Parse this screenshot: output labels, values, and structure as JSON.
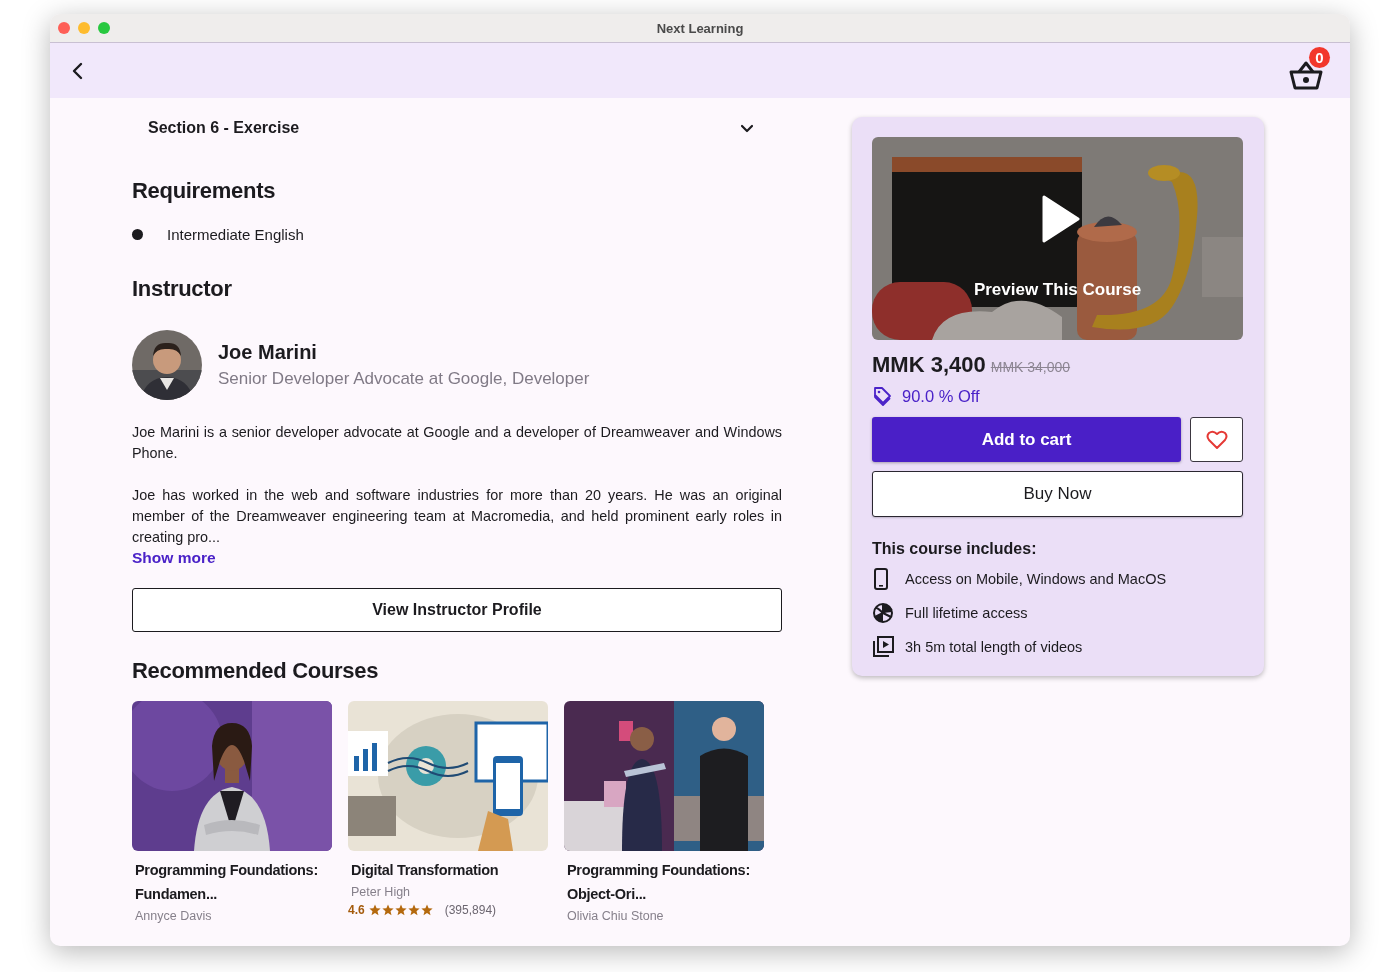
{
  "window": {
    "title": "Next Learning"
  },
  "cart": {
    "count": "0"
  },
  "section": {
    "title": "Section 6 - Exercise",
    "expanded": false
  },
  "requirements": {
    "heading": "Requirements",
    "items": [
      "Intermediate English"
    ]
  },
  "instructor": {
    "heading": "Instructor",
    "name": "Joe Marini",
    "role": "Senior Developer Advocate at Google, Developer",
    "bio": [
      "Joe Marini is a senior developer advocate at Google and a developer of Dreamweaver and Windows Phone.",
      "Joe has worked in the web and software industries for more than 20 years. He was an original member of the Dreamweaver engineering team at Macromedia, and held prominent early roles in creating pro..."
    ],
    "show_more": "Show more",
    "profile_button": "View Instructor Profile"
  },
  "recommended": {
    "heading": "Recommended Courses",
    "courses": [
      {
        "title": "Programming Foundations: Fundamen...",
        "author": "Annyce Davis"
      },
      {
        "title": "Digital Transformation",
        "author": "Peter High",
        "rating": "4.6",
        "stars": 5,
        "reviews": "(395,894)"
      },
      {
        "title": "Programming Foundations: Object-Ori...",
        "author": "Olivia Chiu Stone"
      }
    ]
  },
  "purchase": {
    "preview_label": "Preview This Course",
    "price": "MMK 3,400",
    "original_price": "MMK 34,000",
    "discount": "90.0 % Off",
    "add_to_cart": "Add to cart",
    "wishlisted": false,
    "buy_now": "Buy Now",
    "includes_heading": "This course includes:",
    "includes": [
      {
        "kind": "mobile",
        "text": "Access on Mobile, Windows and MacOS"
      },
      {
        "kind": "lifetime",
        "text": "Full lifetime access"
      },
      {
        "kind": "video",
        "text": "3h 5m total length of videos"
      }
    ]
  }
}
